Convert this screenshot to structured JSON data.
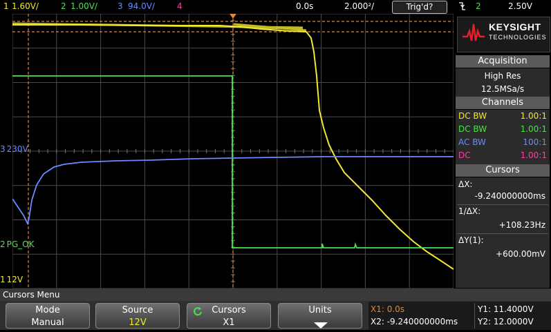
{
  "topbar": {
    "ch1_num": "1",
    "ch1_scale": "1.60V/",
    "ch2_num": "2",
    "ch2_scale": "1.00V/",
    "ch3_num": "3",
    "ch3_scale": "94.0V/",
    "ch4_num": "4",
    "time_offset": "0.0s",
    "time_scale": "2.000²/",
    "trigger_status": "Trig'd?",
    "trigger_icon": "falling-edge-icon",
    "trigger_channel": "2",
    "trigger_level": "2.50V"
  },
  "markers": {
    "ch3_label": "230V",
    "ch2_label": "PG_OK",
    "ch1_label": "12V",
    "ch3_num": "3",
    "ch2_num": "2",
    "ch1_num": "1"
  },
  "panel": {
    "brand": "KEYSIGHT",
    "brand_sub": "TECHNOLOGIES",
    "acquisition_title": "Acquisition",
    "acq_mode": "High Res",
    "acq_rate": "12.5MSa/s",
    "channels_title": "Channels",
    "channels": [
      {
        "coupling": "DC BW",
        "probe": "1.00:1",
        "color": "#f2ea2d"
      },
      {
        "coupling": "DC BW",
        "probe": "1.00:1",
        "color": "#4be34b"
      },
      {
        "coupling": "AC BW",
        "probe": "100:1",
        "color": "#6a8cff"
      },
      {
        "coupling": "DC",
        "probe": "1.00:1",
        "color": "#ff3fa0"
      }
    ],
    "cursors_title": "Cursors",
    "delta_x_label": "ΔX:",
    "delta_x_value": "-9.240000000ms",
    "inv_delta_x_label": "1/ΔX:",
    "inv_delta_x_value": "+108.23Hz",
    "delta_y_label": "ΔY(1):",
    "delta_y_value": "+600.00mV"
  },
  "menu": {
    "title": "Cursors Menu",
    "mode_label": "Mode",
    "mode_value": "Manual",
    "source_label": "Source",
    "source_value": "12V",
    "cursors_label": "Cursors",
    "cursors_value": "X1",
    "units_label": "Units"
  },
  "readout": {
    "x1": "X1: 0.0s",
    "x2": "X2: -9.240000000ms",
    "y1": "Y1: 11.4000V",
    "y2": "Y2: 12.0000V"
  },
  "colors": {
    "ch1": "#f2ea2d",
    "ch2": "#4be34b",
    "ch3": "#6a8cff",
    "ch4": "#ff3fa0",
    "cursor": "#e08a3c",
    "grid": "#4a4a4a"
  }
}
